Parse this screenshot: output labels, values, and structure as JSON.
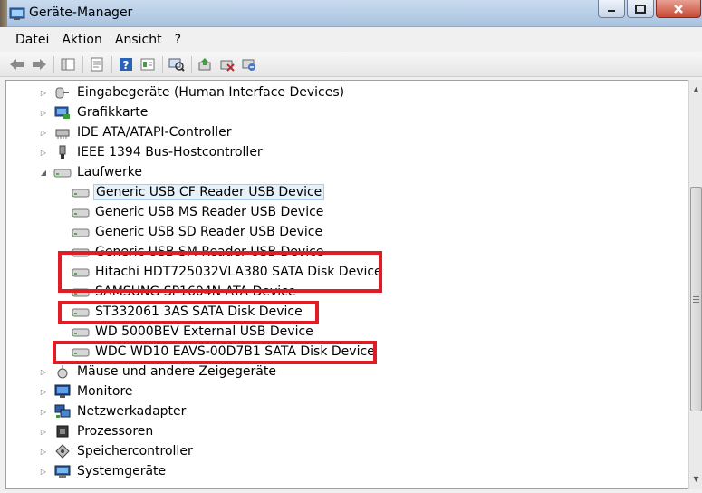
{
  "window": {
    "title": "Geräte-Manager"
  },
  "menu": [
    "Datei",
    "Aktion",
    "Ansicht",
    "?"
  ],
  "toolbar": {
    "icons": [
      "back-arrow-icon",
      "forward-arrow-icon",
      "console-tree-icon",
      "properties-icon",
      "help-icon",
      "view-icon",
      "scan-hardware-icon",
      "update-driver-icon",
      "uninstall-icon",
      "disable-device-icon"
    ]
  },
  "tree": {
    "categories": [
      {
        "label": "Eingabegeräte (Human Interface Devices)",
        "icon": "hid-icon",
        "expanded": false
      },
      {
        "label": "Grafikkarte",
        "icon": "display-adapter-icon",
        "expanded": false
      },
      {
        "label": "IDE ATA/ATAPI-Controller",
        "icon": "ide-controller-icon",
        "expanded": false
      },
      {
        "label": "IEEE 1394 Bus-Hostcontroller",
        "icon": "firewire-icon",
        "expanded": false
      },
      {
        "label": "Laufwerke",
        "icon": "disk-drive-icon",
        "expanded": true
      },
      {
        "label": "Mäuse und andere Zeigegeräte",
        "icon": "mouse-icon",
        "expanded": false
      },
      {
        "label": "Monitore",
        "icon": "monitor-icon",
        "expanded": false
      },
      {
        "label": "Netzwerkadapter",
        "icon": "network-adapter-icon",
        "expanded": false
      },
      {
        "label": "Prozessoren",
        "icon": "processor-icon",
        "expanded": false
      },
      {
        "label": "Speichercontroller",
        "icon": "storage-controller-icon",
        "expanded": false
      },
      {
        "label": "Systemgeräte",
        "icon": "system-devices-icon",
        "expanded": false
      }
    ],
    "drives": [
      {
        "label": "Generic USB CF Reader USB Device",
        "selected": true,
        "highlighted": false
      },
      {
        "label": "Generic USB MS Reader USB Device",
        "selected": false,
        "highlighted": false
      },
      {
        "label": "Generic USB SD Reader USB Device",
        "selected": false,
        "highlighted": false
      },
      {
        "label": "Generic USB SM Reader USB Device",
        "selected": false,
        "highlighted": false
      },
      {
        "label": "Hitachi HDT725032VLA380 SATA Disk Device",
        "selected": false,
        "highlighted": true
      },
      {
        "label": "SAMSUNG SP1604N ATA Device",
        "selected": false,
        "highlighted": false
      },
      {
        "label": "ST332061 3AS SATA Disk Device",
        "selected": false,
        "highlighted": true
      },
      {
        "label": "WD 5000BEV External USB Device",
        "selected": false,
        "highlighted": false
      },
      {
        "label": "WDC WD10 EAVS-00D7B1 SATA Disk Device",
        "selected": false,
        "highlighted": true
      }
    ]
  },
  "colors": {
    "highlight_box": "#e01c24",
    "selection": "#e5f1fb",
    "title_bar": "#b8cfe8"
  }
}
